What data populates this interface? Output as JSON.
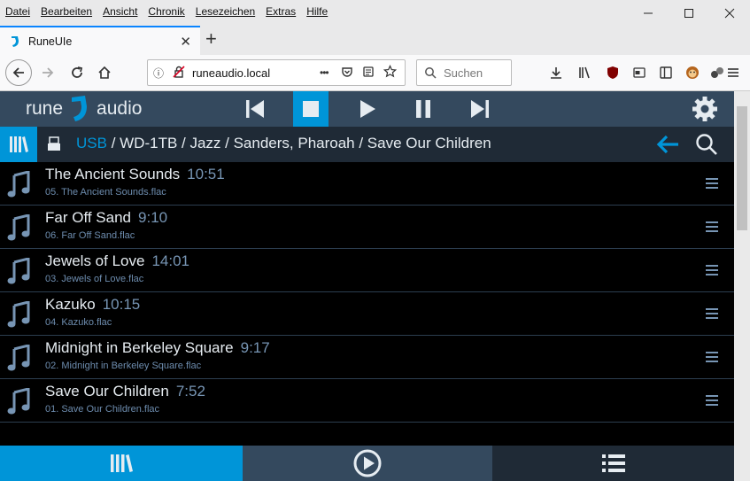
{
  "browser": {
    "menu": [
      "Datei",
      "Bearbeiten",
      "Ansicht",
      "Chronik",
      "Lesezeichen",
      "Extras",
      "Hilfe"
    ],
    "tab_title": "RuneUIe",
    "url": "runeaudio.local",
    "search_placeholder": "Suchen",
    "url_more": "•••"
  },
  "app": {
    "logo_left": "rune",
    "logo_right": "audio",
    "accent": "#0095d8",
    "header_bg": "#34495e"
  },
  "breadcrumb": {
    "root": "USB",
    "path": " / WD-1TB / Jazz / Sanders, Pharoah / Save Our Children"
  },
  "tracks": [
    {
      "title": "The Ancient Sounds",
      "duration": "10:51",
      "file": "05. The Ancient Sounds.flac"
    },
    {
      "title": "Far Off Sand",
      "duration": "9:10",
      "file": "06. Far Off Sand.flac"
    },
    {
      "title": "Jewels of Love",
      "duration": "14:01",
      "file": "03. Jewels of Love.flac"
    },
    {
      "title": "Kazuko",
      "duration": "10:15",
      "file": "04. Kazuko.flac"
    },
    {
      "title": "Midnight in Berkeley Square",
      "duration": "9:17",
      "file": "02. Midnight in Berkeley Square.flac"
    },
    {
      "title": "Save Our Children",
      "duration": "7:52",
      "file": "01. Save Our Children.flac"
    }
  ]
}
